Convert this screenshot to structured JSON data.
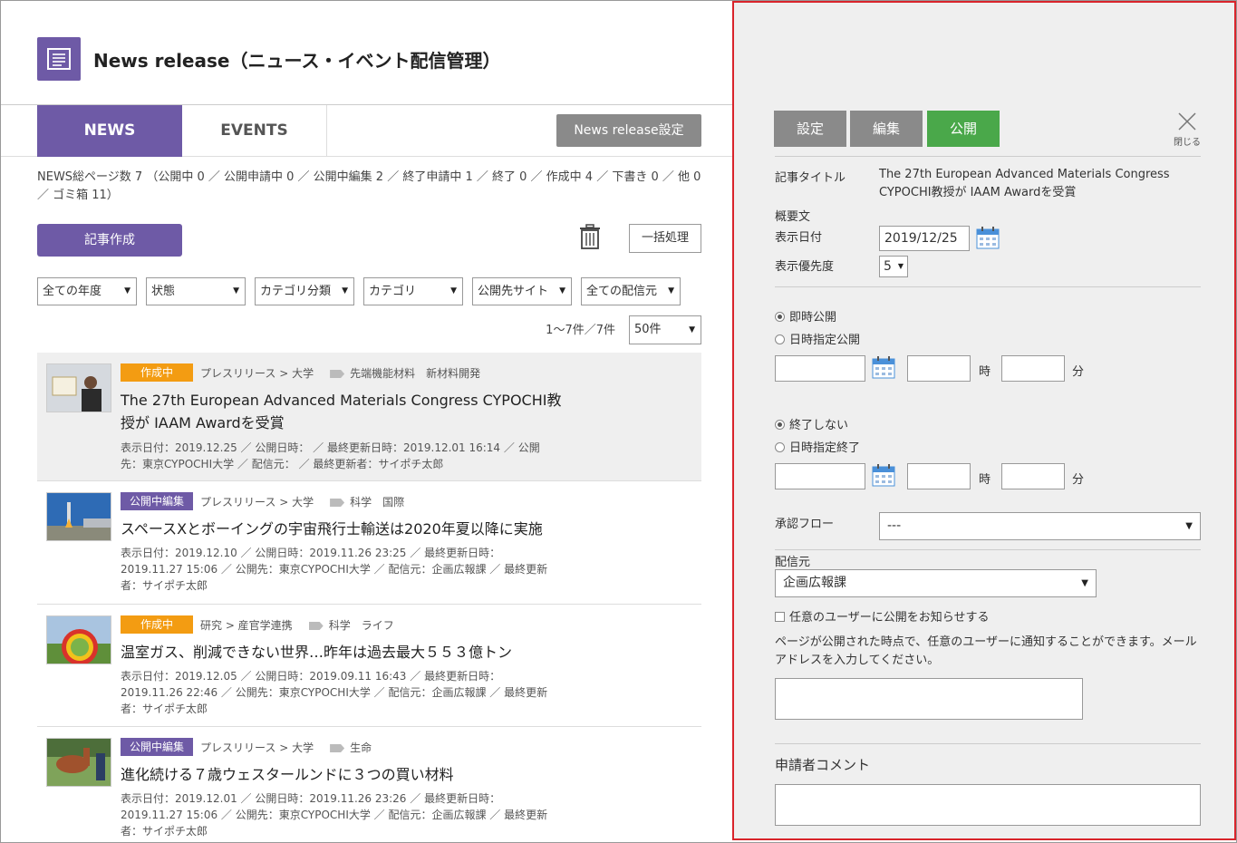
{
  "header": {
    "title": "News release（ニュース・イベント配信管理）",
    "icon": "news-document-icon"
  },
  "tabs": [
    {
      "label": "NEWS",
      "active": true
    },
    {
      "label": "EVENTS",
      "active": false
    }
  ],
  "toolbar": {
    "settings_label": "News release設定",
    "summary": "NEWS総ページ数 7 （公開中 0 ／ 公開申請中 0 ／ 公開中編集 2 ／ 終了申請中 1 ／ 終了 0 ／ 作成中 4 ／ 下書き 0 ／ 他 0 ／ ゴミ箱 11）",
    "create_label": "記事作成",
    "bulk_label": "一括処理"
  },
  "filters": [
    {
      "label": "全ての年度"
    },
    {
      "label": "状態"
    },
    {
      "label": "カテゴリ分類"
    },
    {
      "label": "カテゴリ"
    },
    {
      "label": "公開先サイト"
    },
    {
      "label": "全ての配信元"
    }
  ],
  "pagination": {
    "count_text": "1〜7件／7件",
    "per_page": "50件"
  },
  "items": [
    {
      "status": "作成中",
      "status_color": "#f39c12",
      "category": "プレスリリース > 大学",
      "tags": "先端機能材料　新材料開発",
      "title": "The 27th European Advanced Materials Congress CYPOCHI教授が IAAM Awardを受賞",
      "meta": "表示日付：2019.12.25 ／ 公開日時： ／ 最終更新日時：2019.12.01 16:14 ／ 公開先：東京CYPOCHI大学 ／ 配信元： ／ 最終更新者：サイポチ太郎"
    },
    {
      "status": "公開中編集",
      "status_color": "#6e5aa6",
      "category": "プレスリリース > 大学",
      "tags": "科学　国際",
      "title": "スペースXとボーイングの宇宙飛行士輸送は2020年夏以降に実施",
      "meta": "表示日付：2019.12.10 ／ 公開日時：2019.11.26 23:25 ／ 最終更新日時：2019.11.27 15:06 ／ 公開先：東京CYPOCHI大学 ／ 配信元：企画広報課 ／ 最終更新者：サイポチ太郎"
    },
    {
      "status": "作成中",
      "status_color": "#f39c12",
      "category": "研究 > 産官学連携",
      "tags": "科学　ライフ",
      "title": "温室ガス、削減できない世界…昨年は過去最大５５３億トン",
      "meta": "表示日付：2019.12.05 ／ 公開日時：2019.09.11 16:43 ／ 最終更新日時：2019.11.26 22:46 ／ 公開先：東京CYPOCHI大学 ／ 配信元：企画広報課 ／ 最終更新者：サイポチ太郎"
    },
    {
      "status": "公開中編集",
      "status_color": "#6e5aa6",
      "category": "プレスリリース > 大学",
      "tags": "生命",
      "title": "進化続ける７歳ウェスタールンドに３つの買い材料",
      "meta": "表示日付：2019.12.01 ／ 公開日時：2019.11.26 23:26 ／ 最終更新日時：2019.11.27 15:06 ／ 公開先：東京CYPOCHI大学 ／ 配信元：企画広報課 ／ 最終更新者：サイポチ太郎"
    }
  ],
  "panel": {
    "tabs": [
      {
        "label": "設定"
      },
      {
        "label": "編集"
      },
      {
        "label": "公開"
      }
    ],
    "close_label": "閉じる",
    "article_title_label": "記事タイトル",
    "article_title": "The 27th European Advanced Materials Congress CYPOCHI教授が IAAM Awardを受賞",
    "summary_label": "概要文",
    "date_label": "表示日付",
    "date_value": "2019/12/25",
    "priority_label": "表示優先度",
    "priority_value": "5",
    "publish_now": "即時公開",
    "publish_scheduled": "日時指定公開",
    "end_none": "終了しない",
    "end_scheduled": "日時指定終了",
    "hour_unit": "時",
    "minute_unit": "分",
    "approval_label": "承認フロー",
    "approval_value": "---",
    "source_label": "配信元",
    "source_value": "企画広報課",
    "notify_label": "任意のユーザーに公開をお知らせする",
    "notify_desc": "ページが公開された時点で、任意のユーザーに通知することができます。メールアドレスを入力してください。",
    "comment_label": "申請者コメント"
  }
}
